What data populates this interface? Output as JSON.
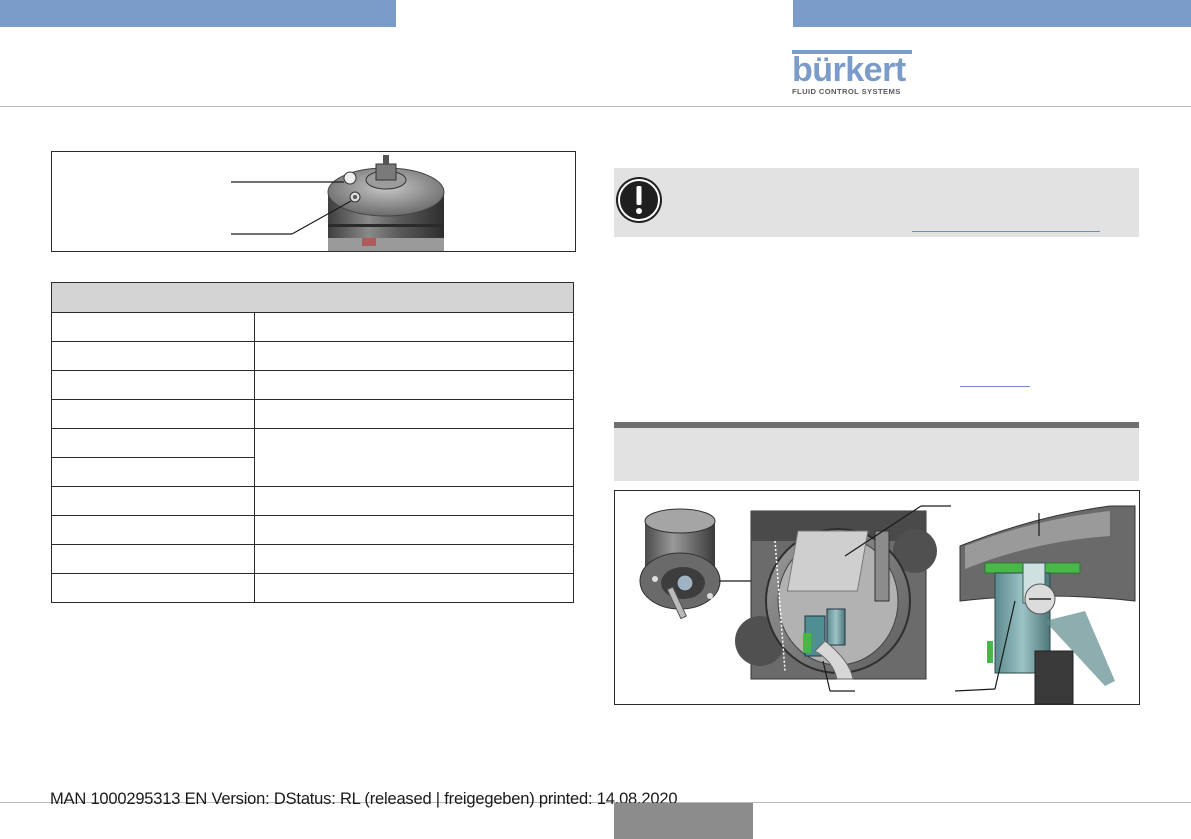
{
  "brand": {
    "logo_text": "bürkert",
    "logo_subtitle": "FLUID CONTROL SYSTEMS",
    "color_primary": "#7b9bc9"
  },
  "icons": {
    "note": "exclamation-circle-icon"
  },
  "footer": {
    "text": "MAN  1000295313  EN  Version: DStatus: RL (released | freigegeben)  printed: 14.08.2020"
  }
}
